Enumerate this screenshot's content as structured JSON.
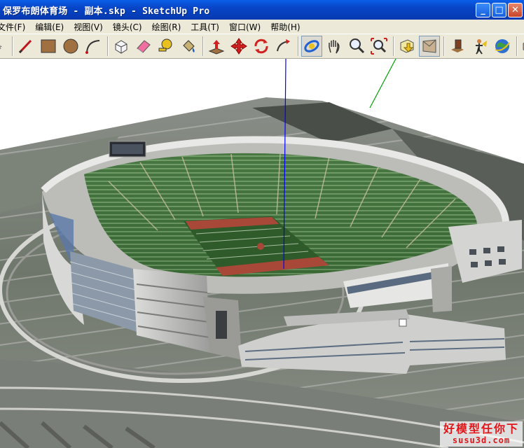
{
  "window": {
    "title": "保罗布朗体育场 - 副本.skp - SketchUp Pro",
    "minimize_glyph": "_",
    "maximize_glyph": "□",
    "close_glyph": "✕"
  },
  "menu": [
    {
      "label": "文件(F)"
    },
    {
      "label": "编辑(E)"
    },
    {
      "label": "视图(V)"
    },
    {
      "label": "镜头(C)"
    },
    {
      "label": "绘图(R)"
    },
    {
      "label": "工具(T)"
    },
    {
      "label": "窗口(W)"
    },
    {
      "label": "帮助(H)"
    }
  ],
  "toolbar": {
    "tools": [
      "select-icon",
      "pencil-icon",
      "rectangle-icon",
      "circle-icon",
      "arc-icon",
      "make-component-icon",
      "eraser-icon",
      "tape-measure-icon",
      "paint-bucket-icon",
      "push-pull-icon",
      "move-icon",
      "rotate-icon",
      "follow-me-icon",
      "orbit-icon",
      "pan-icon",
      "zoom-icon",
      "zoom-extents-icon",
      "previous-view-icon",
      "next-view-icon",
      "add-location-icon",
      "position-camera-icon",
      "google-earth-icon",
      "get-models-icon"
    ],
    "pressed_tool": "orbit-icon"
  },
  "colors": {
    "titlebar": "#0845c7",
    "chrome": "#ece9d8",
    "field": "#2f5a2a",
    "seats": "#3f6e3a",
    "concrete": "#c9c9c6",
    "axis_blue": "#0000ff",
    "axis_green": "#00a000",
    "watermark_red": "#e0161a"
  },
  "watermark": {
    "line1": "好模型任你下",
    "line2": "susu3d.com"
  }
}
